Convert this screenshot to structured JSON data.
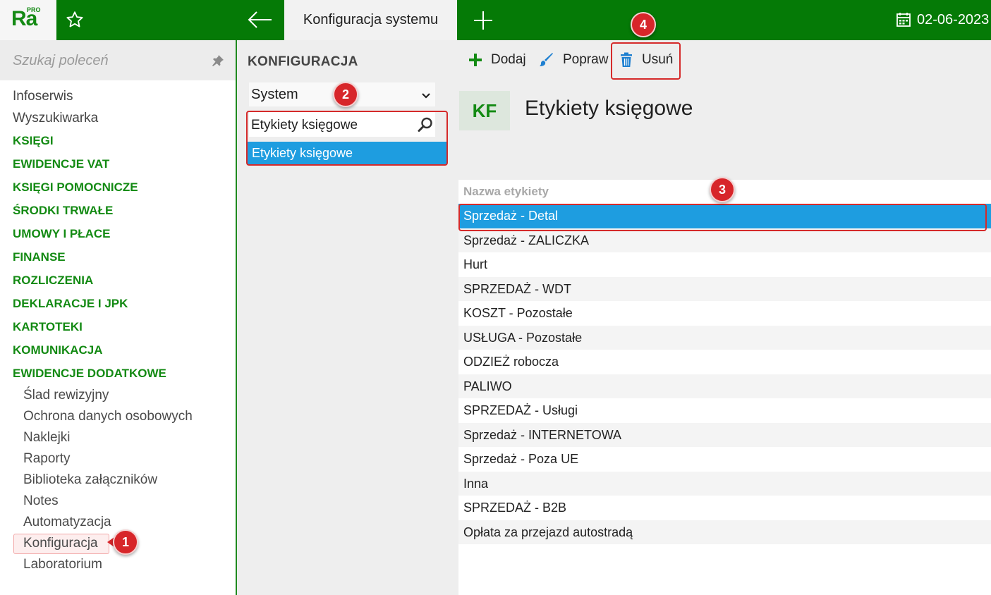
{
  "app": {
    "logo_text": "Ra",
    "logo_sup": "PRO",
    "active_tab": "Konfiguracja systemu",
    "date": "02-06-2023"
  },
  "sidebar": {
    "search_placeholder": "Szukaj poleceń",
    "plain_items": [
      "Infoserwis",
      "Wyszukiwarka"
    ],
    "sections": [
      "KSIĘGI",
      "EWIDENCJE VAT",
      "KSIĘGI POMOCNICZE",
      "ŚRODKI TRWAŁE",
      "UMOWY I PŁACE",
      "FINANSE",
      "ROZLICZENIA",
      "DEKLARACJE I JPK",
      "KARTOTEKI",
      "KOMUNIKACJA",
      "EWIDENCJE DODATKOWE"
    ],
    "sub_items": [
      "Ślad rewizyjny",
      "Ochrona danych osobowych",
      "Naklejki",
      "Raporty",
      "Biblioteka załączników",
      "Notes",
      "Automatyzacja",
      "Konfiguracja",
      "Laboratorium"
    ]
  },
  "config_panel": {
    "title": "KONFIGURACJA",
    "select_value": "System",
    "search_value": "Etykiety księgowe",
    "result": "Etykiety księgowe"
  },
  "toolbar": {
    "add_label": "Dodaj",
    "edit_label": "Popraw",
    "delete_label": "Usuń"
  },
  "content": {
    "badge": "KF",
    "title": "Etykiety księgowe",
    "column_header": "Nazwa etykiety",
    "rows": [
      "Sprzedaż - Detal",
      "Sprzedaż - ZALICZKA",
      "Hurt",
      "SPRZEDAŻ - WDT",
      "KOSZT - Pozostałe",
      "USŁUGA - Pozostałe",
      "ODZIEŻ robocza",
      "PALIWO",
      "SPRZEDAŻ - Usługi",
      "Sprzedaż - INTERNETOWA",
      "Sprzedaż - Poza UE",
      "Inna",
      "SPRZEDAŻ - B2B",
      "Opłata za przejazd autostradą"
    ],
    "selected_row": "Sprzedaż - Detal"
  },
  "annotations": {
    "badge1": "1",
    "badge2": "2",
    "badge3": "3",
    "badge4": "4"
  },
  "colors": {
    "topbar": "#057a06",
    "section_green": "#138a13",
    "selection_blue": "#1e9de0",
    "annotation_red": "#d7262a"
  }
}
